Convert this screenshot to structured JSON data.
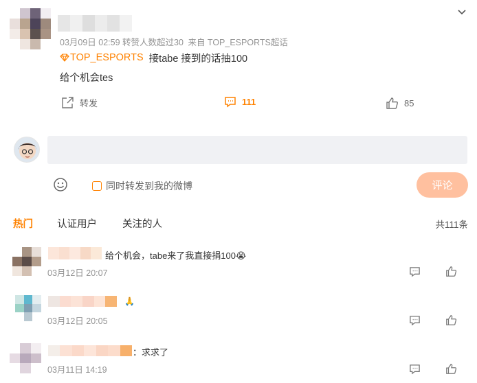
{
  "post": {
    "meta_time": "03月09日 02:59",
    "meta_tag": "转赞人数超过30",
    "meta_source": "来自 TOP_ESPORTS超话",
    "supertopic_name": "TOP_ESPORTS",
    "text_line1": "接tabe 接到的话抽100",
    "text_line2": "给个机会tes",
    "repost_label": "转发",
    "comment_count": "111",
    "like_count": "85",
    "icons": [
      "chevron-down-icon",
      "supertopic-diamond-icon",
      "repost-icon",
      "comment-icon",
      "thumbs-up-icon"
    ]
  },
  "composer": {
    "input_placeholder": "",
    "emoji_icon": "smiley-icon",
    "repost_checkbox_label": "同时转发到我的微博",
    "submit_label": "评论",
    "accent_color": "#ff8200",
    "submit_disabled_color": "#ffc09f"
  },
  "tabs": {
    "items": [
      "热门",
      "认证用户",
      "关注的人"
    ],
    "active": "热门",
    "total": "共111条"
  },
  "comments": [
    {
      "text": "给个机会，tabe来了我直接捐100",
      "emoji": "😭",
      "time": "03月12日 20:07"
    },
    {
      "text": "",
      "emoji": "🙏",
      "time": "03月12日 20:05"
    },
    {
      "text": "：求求了",
      "emoji": "",
      "time": "03月11日 14:19"
    }
  ]
}
